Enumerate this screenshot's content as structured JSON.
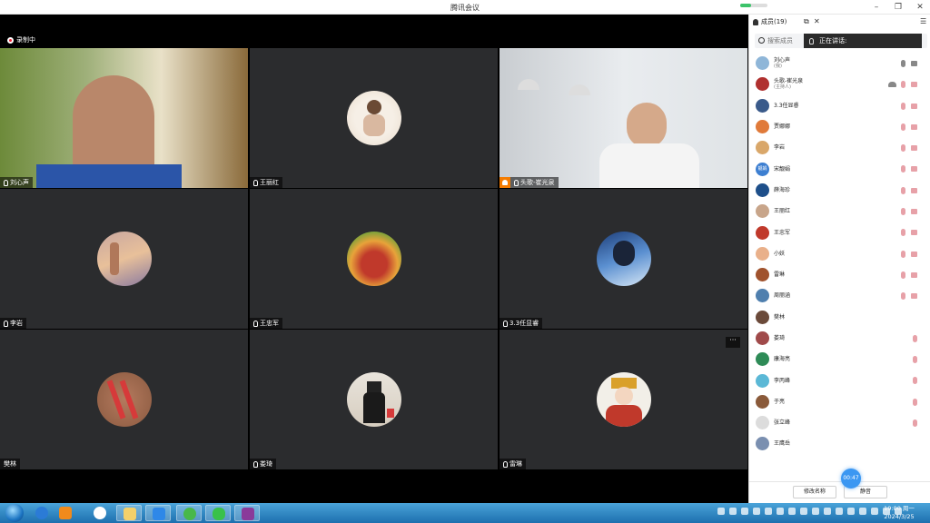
{
  "window": {
    "title": "腾讯会议"
  },
  "recording": {
    "label": "录制中"
  },
  "tiles": [
    {
      "name": "刘心声",
      "kind": "camera"
    },
    {
      "name": "王丽红",
      "kind": "avatar"
    },
    {
      "name": "头歌-崔光泉",
      "kind": "camera",
      "host": true
    },
    {
      "name": "李岩",
      "kind": "avatar"
    },
    {
      "name": "王忠军",
      "kind": "avatar"
    },
    {
      "name": "3.3任显睿",
      "kind": "avatar"
    },
    {
      "name": "樊林",
      "kind": "avatar"
    },
    {
      "name": "娄琦",
      "kind": "avatar"
    },
    {
      "name": "雷琳",
      "kind": "avatar"
    }
  ],
  "tile_more": "···",
  "panel": {
    "title": "成员(19)",
    "search_placeholder": "搜索成员",
    "speaking": "正在讲话:",
    "members": [
      {
        "name": "刘心声",
        "sub": "(我)",
        "color": "#8fb6d8",
        "mic": "on",
        "cam": "on"
      },
      {
        "name": "头歌-崔光泉",
        "sub": "(主持人)",
        "color": "#b0302f",
        "mic": "off",
        "cam": "off",
        "extra": true
      },
      {
        "name": "3.3任显睿",
        "sub": "",
        "color": "#3a5a8a",
        "mic": "off",
        "cam": "off"
      },
      {
        "name": "贾娜娜",
        "sub": "",
        "color": "#e07a3a",
        "mic": "off",
        "cam": "off"
      },
      {
        "name": "李岩",
        "sub": "",
        "color": "#d9a76a",
        "mic": "off",
        "cam": "off"
      },
      {
        "name": "宋靓娟",
        "sub": "",
        "color": "#3d7fd1",
        "avatar_text": "靓娟",
        "mic": "off",
        "cam": "off"
      },
      {
        "name": "薛海珍",
        "sub": "",
        "color": "#1e4f8a",
        "mic": "off",
        "cam": "off"
      },
      {
        "name": "王丽红",
        "sub": "",
        "color": "#c8a58a",
        "mic": "off",
        "cam": "off"
      },
      {
        "name": "王忠军",
        "sub": "",
        "color": "#c0392b",
        "mic": "off",
        "cam": "off"
      },
      {
        "name": "小妖",
        "sub": "",
        "color": "#e9b08a",
        "mic": "off",
        "cam": "off"
      },
      {
        "name": "雷琳",
        "sub": "",
        "color": "#a0522d",
        "mic": "off",
        "cam": "off"
      },
      {
        "name": "周丽涵",
        "sub": "",
        "color": "#4f7fae",
        "mic": "off",
        "cam": "off"
      },
      {
        "name": "樊林",
        "sub": "",
        "color": "#6b4a3a",
        "mic": "",
        "cam": ""
      },
      {
        "name": "娄琦",
        "sub": "",
        "color": "#a04a4a",
        "mic": "off",
        "cam": ""
      },
      {
        "name": "康海亮",
        "sub": "",
        "color": "#2e8b57",
        "mic": "off",
        "cam": ""
      },
      {
        "name": "李丙峰",
        "sub": "",
        "color": "#5bb8d6",
        "mic": "off",
        "cam": ""
      },
      {
        "name": "于亮",
        "sub": "",
        "color": "#8a5a3a",
        "mic": "off",
        "cam": ""
      },
      {
        "name": "张立峰",
        "sub": "",
        "color": "#dcdcdc",
        "mic": "off",
        "cam": ""
      },
      {
        "name": "王鹰岳",
        "sub": "",
        "color": "#7a8fb0",
        "mic": "",
        "cam": ""
      }
    ],
    "rename_button": "修改名称",
    "mute_button": "静音",
    "timer": "00:47"
  },
  "taskbar": {
    "time": "19:00 周一",
    "date": "2024/3/25"
  }
}
